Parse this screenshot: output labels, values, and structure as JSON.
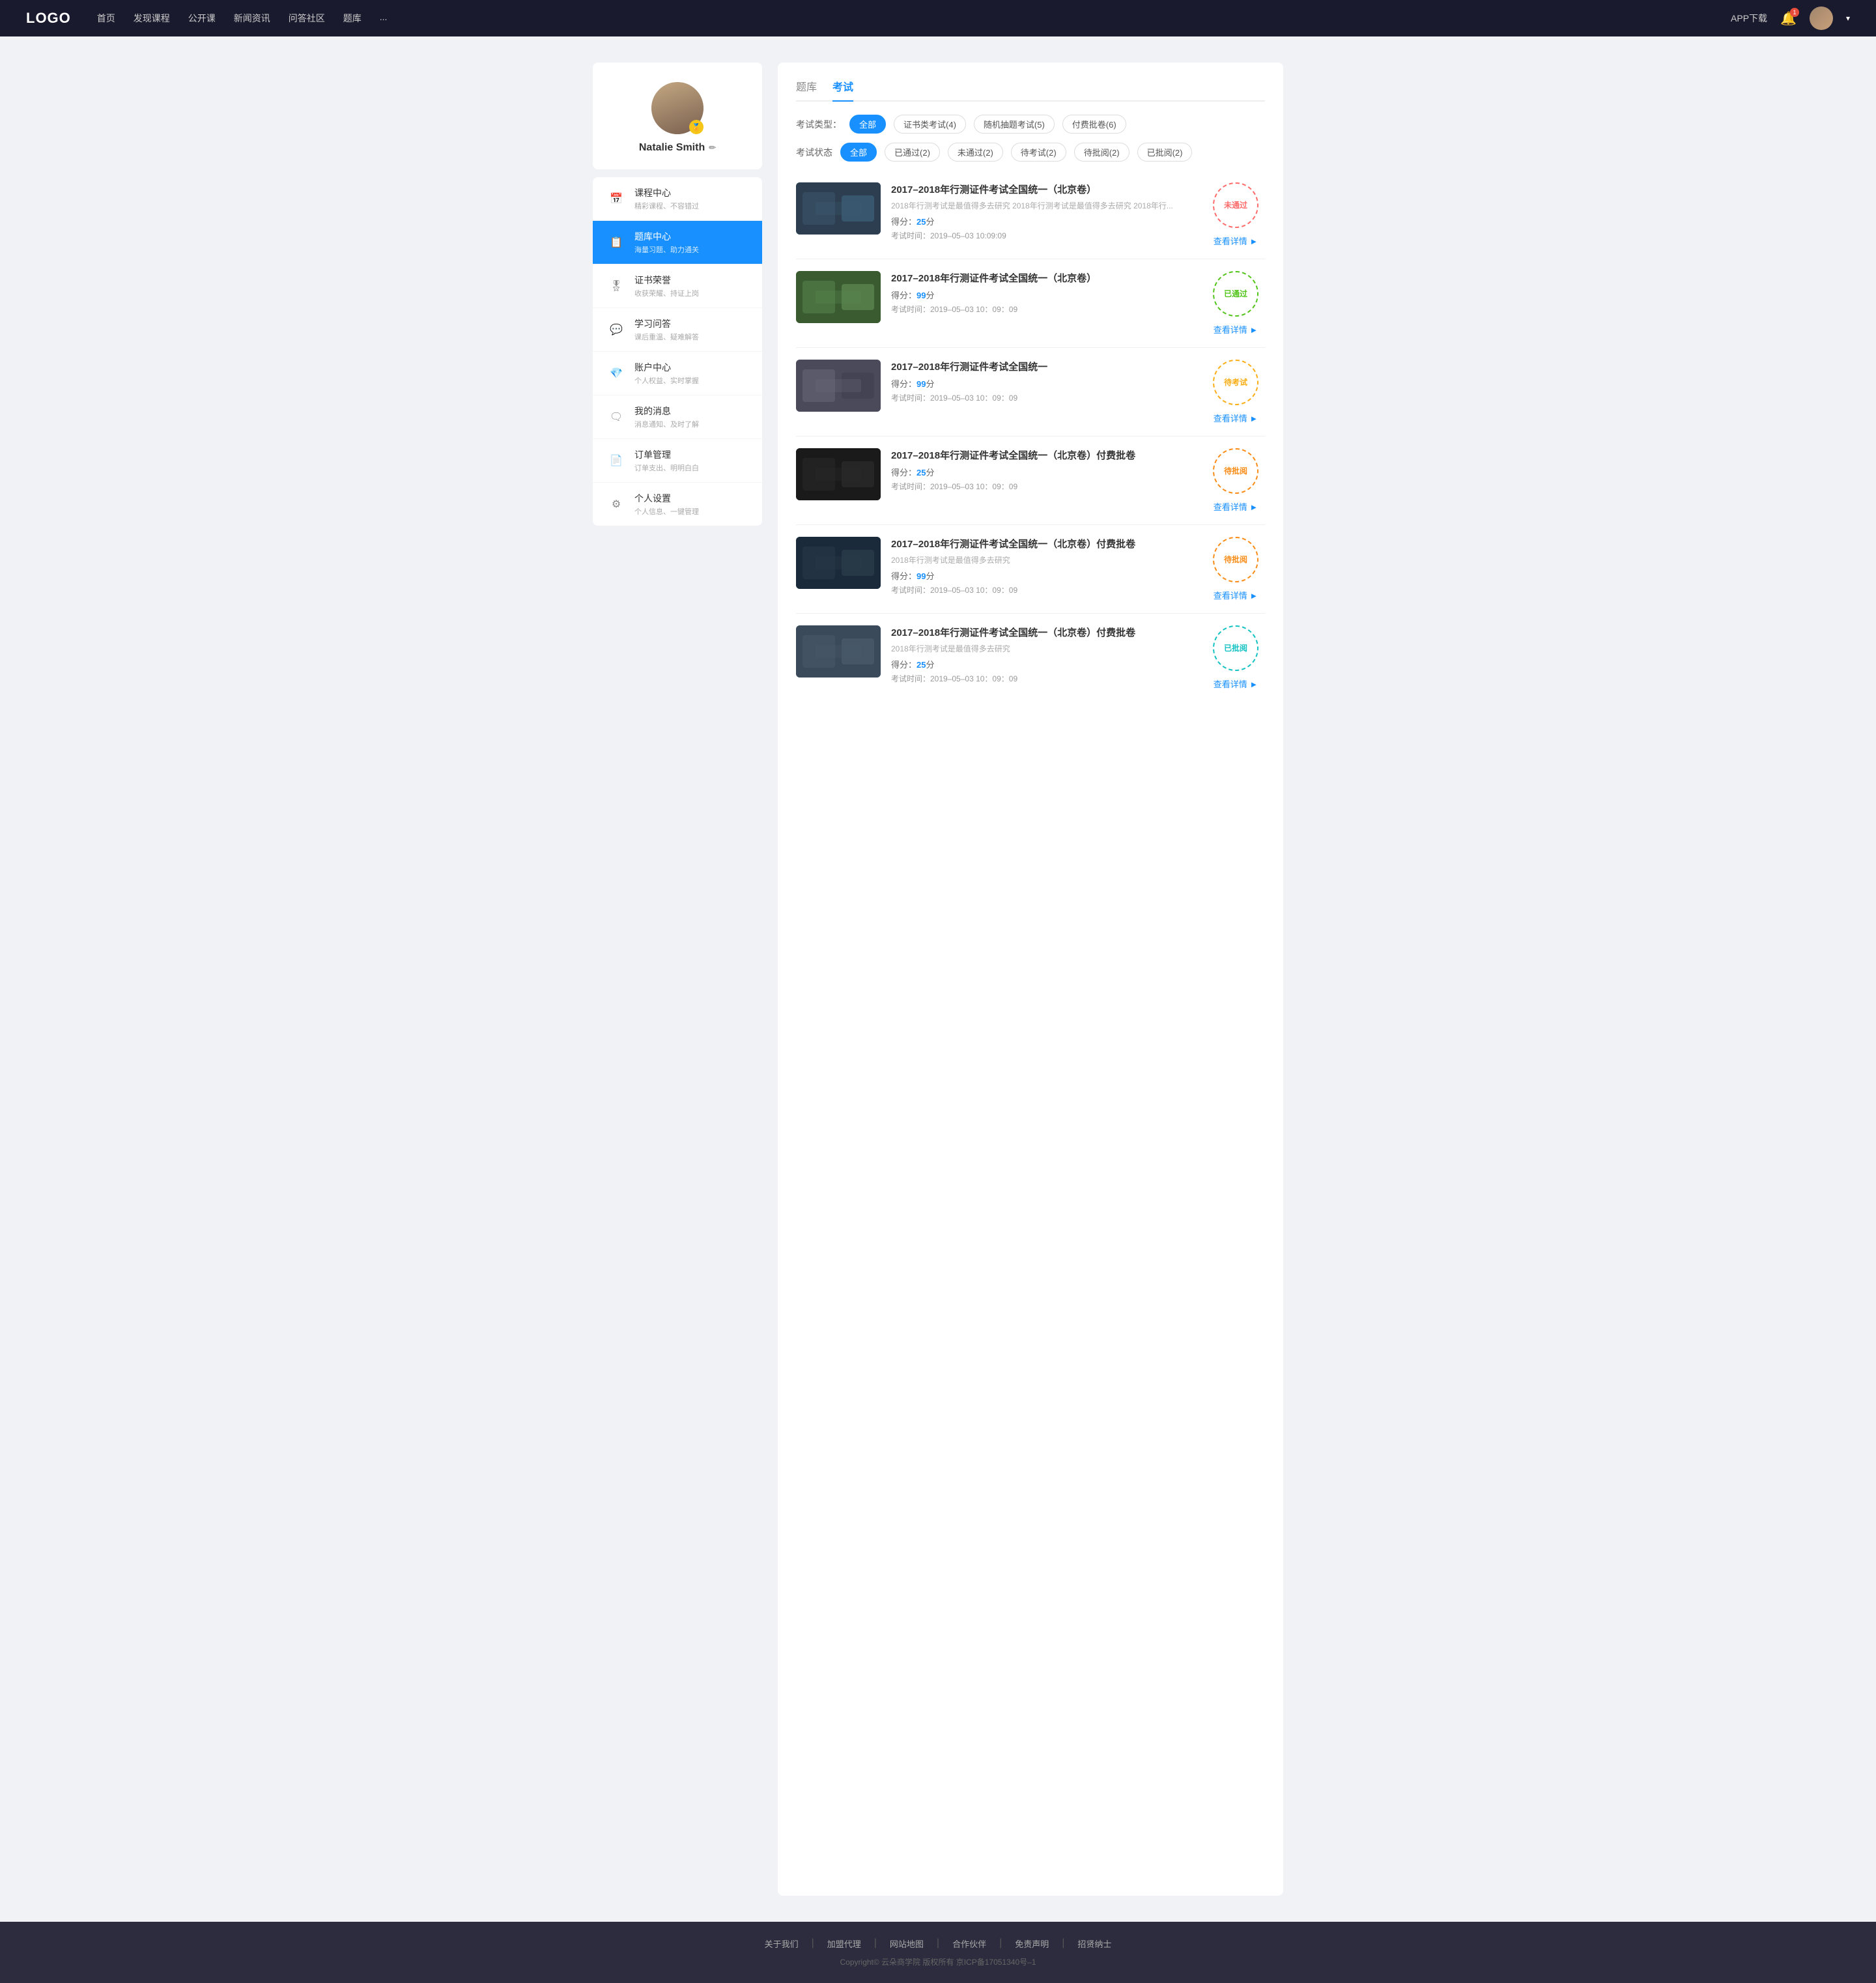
{
  "header": {
    "logo": "LOGO",
    "nav": [
      {
        "label": "首页",
        "href": "#"
      },
      {
        "label": "发现课程",
        "href": "#"
      },
      {
        "label": "公开课",
        "href": "#"
      },
      {
        "label": "新闻资讯",
        "href": "#"
      },
      {
        "label": "问答社区",
        "href": "#"
      },
      {
        "label": "题库",
        "href": "#"
      },
      {
        "label": "...",
        "href": "#"
      }
    ],
    "app_download": "APP下载",
    "bell_badge": "1",
    "dropdown_arrow": "▾"
  },
  "sidebar": {
    "username": "Natalie Smith",
    "badge": "🏅",
    "edit_icon": "✏",
    "menu": [
      {
        "id": "course",
        "icon": "📅",
        "label": "课程中心",
        "sub": "精彩课程、不容错过",
        "active": false
      },
      {
        "id": "question-bank",
        "icon": "📋",
        "label": "题库中心",
        "sub": "海量习题、助力通关",
        "active": true
      },
      {
        "id": "certificate",
        "icon": "🎖",
        "label": "证书荣誉",
        "sub": "收获荣耀、持证上岗",
        "active": false
      },
      {
        "id": "qa",
        "icon": "💬",
        "label": "学习问答",
        "sub": "课后重温、疑难解答",
        "active": false
      },
      {
        "id": "account",
        "icon": "💎",
        "label": "账户中心",
        "sub": "个人权益、实时掌握",
        "active": false
      },
      {
        "id": "messages",
        "icon": "🗨",
        "label": "我的消息",
        "sub": "消息通知、及时了解",
        "active": false
      },
      {
        "id": "orders",
        "icon": "📄",
        "label": "订单管理",
        "sub": "订单支出、明明白白",
        "active": false
      },
      {
        "id": "settings",
        "icon": "⚙",
        "label": "个人设置",
        "sub": "个人信息、一键管理",
        "active": false
      }
    ]
  },
  "content": {
    "tabs": [
      {
        "label": "题库",
        "active": false
      },
      {
        "label": "考试",
        "active": true
      }
    ],
    "filter_type_label": "考试类型：",
    "filter_type_options": [
      {
        "label": "全部",
        "active": true
      },
      {
        "label": "证书类考试(4)",
        "active": false
      },
      {
        "label": "随机抽题考试(5)",
        "active": false
      },
      {
        "label": "付费批卷(6)",
        "active": false
      }
    ],
    "filter_status_label": "考试状态",
    "filter_status_options": [
      {
        "label": "全部",
        "active": true
      },
      {
        "label": "已通过(2)",
        "active": false
      },
      {
        "label": "未通过(2)",
        "active": false
      },
      {
        "label": "待考试(2)",
        "active": false
      },
      {
        "label": "待批阅(2)",
        "active": false
      },
      {
        "label": "已批阅(2)",
        "active": false
      }
    ],
    "exams": [
      {
        "id": 1,
        "title": "2017–2018年行测证件考试全国统一（北京卷）",
        "desc": "2018年行测考试是最值得多去研究 2018年行测考试是最值得多去研究 2018年行...",
        "score_label": "得分：",
        "score": "25",
        "score_unit": "分",
        "time_label": "考试时间：",
        "time": "2019–05–03  10:09:09",
        "status": "未通过",
        "status_type": "fail",
        "action_label": "查看详情",
        "thumb_class": "thumb-1"
      },
      {
        "id": 2,
        "title": "2017–2018年行测证件考试全国统一（北京卷）",
        "desc": "",
        "score_label": "得分：",
        "score": "99",
        "score_unit": "分",
        "time_label": "考试时间：",
        "time": "2019–05–03  10：09：09",
        "status": "已通过",
        "status_type": "pass",
        "action_label": "查看详情",
        "thumb_class": "thumb-2"
      },
      {
        "id": 3,
        "title": "2017–2018年行测证件考试全国统一",
        "desc": "",
        "score_label": "得分：",
        "score": "99",
        "score_unit": "分",
        "time_label": "考试时间：",
        "time": "2019–05–03  10：09：09",
        "status": "待考试",
        "status_type": "pending",
        "action_label": "查看详情",
        "thumb_class": "thumb-3"
      },
      {
        "id": 4,
        "title": "2017–2018年行测证件考试全国统一（北京卷）付费批卷",
        "desc": "",
        "score_label": "得分：",
        "score": "25",
        "score_unit": "分",
        "time_label": "考试时间：",
        "time": "2019–05–03  10：09：09",
        "status": "待批阅",
        "status_type": "review-pending",
        "action_label": "查看详情",
        "thumb_class": "thumb-4"
      },
      {
        "id": 5,
        "title": "2017–2018年行测证件考试全国统一（北京卷）付费批卷",
        "desc": "2018年行测考试是最值得多去研究",
        "score_label": "得分：",
        "score": "99",
        "score_unit": "分",
        "time_label": "考试时间：",
        "time": "2019–05–03  10：09：09",
        "status": "待批阅",
        "status_type": "review-pending",
        "action_label": "查看详情",
        "thumb_class": "thumb-5"
      },
      {
        "id": 6,
        "title": "2017–2018年行测证件考试全国统一（北京卷）付费批卷",
        "desc": "2018年行测考试是最值得多去研究",
        "score_label": "得分：",
        "score": "25",
        "score_unit": "分",
        "time_label": "考试时间：",
        "time": "2019–05–03  10：09：09",
        "status": "已批阅",
        "status_type": "reviewed",
        "action_label": "查看详情",
        "thumb_class": "thumb-6"
      }
    ]
  },
  "footer": {
    "links": [
      {
        "label": "关于我们"
      },
      {
        "label": "加盟代理"
      },
      {
        "label": "网站地图"
      },
      {
        "label": "合作伙伴"
      },
      {
        "label": "免责声明"
      },
      {
        "label": "招贤纳士"
      }
    ],
    "copyright": "Copyright© 云朵商学院  版权所有    京ICP备17051340号–1"
  }
}
